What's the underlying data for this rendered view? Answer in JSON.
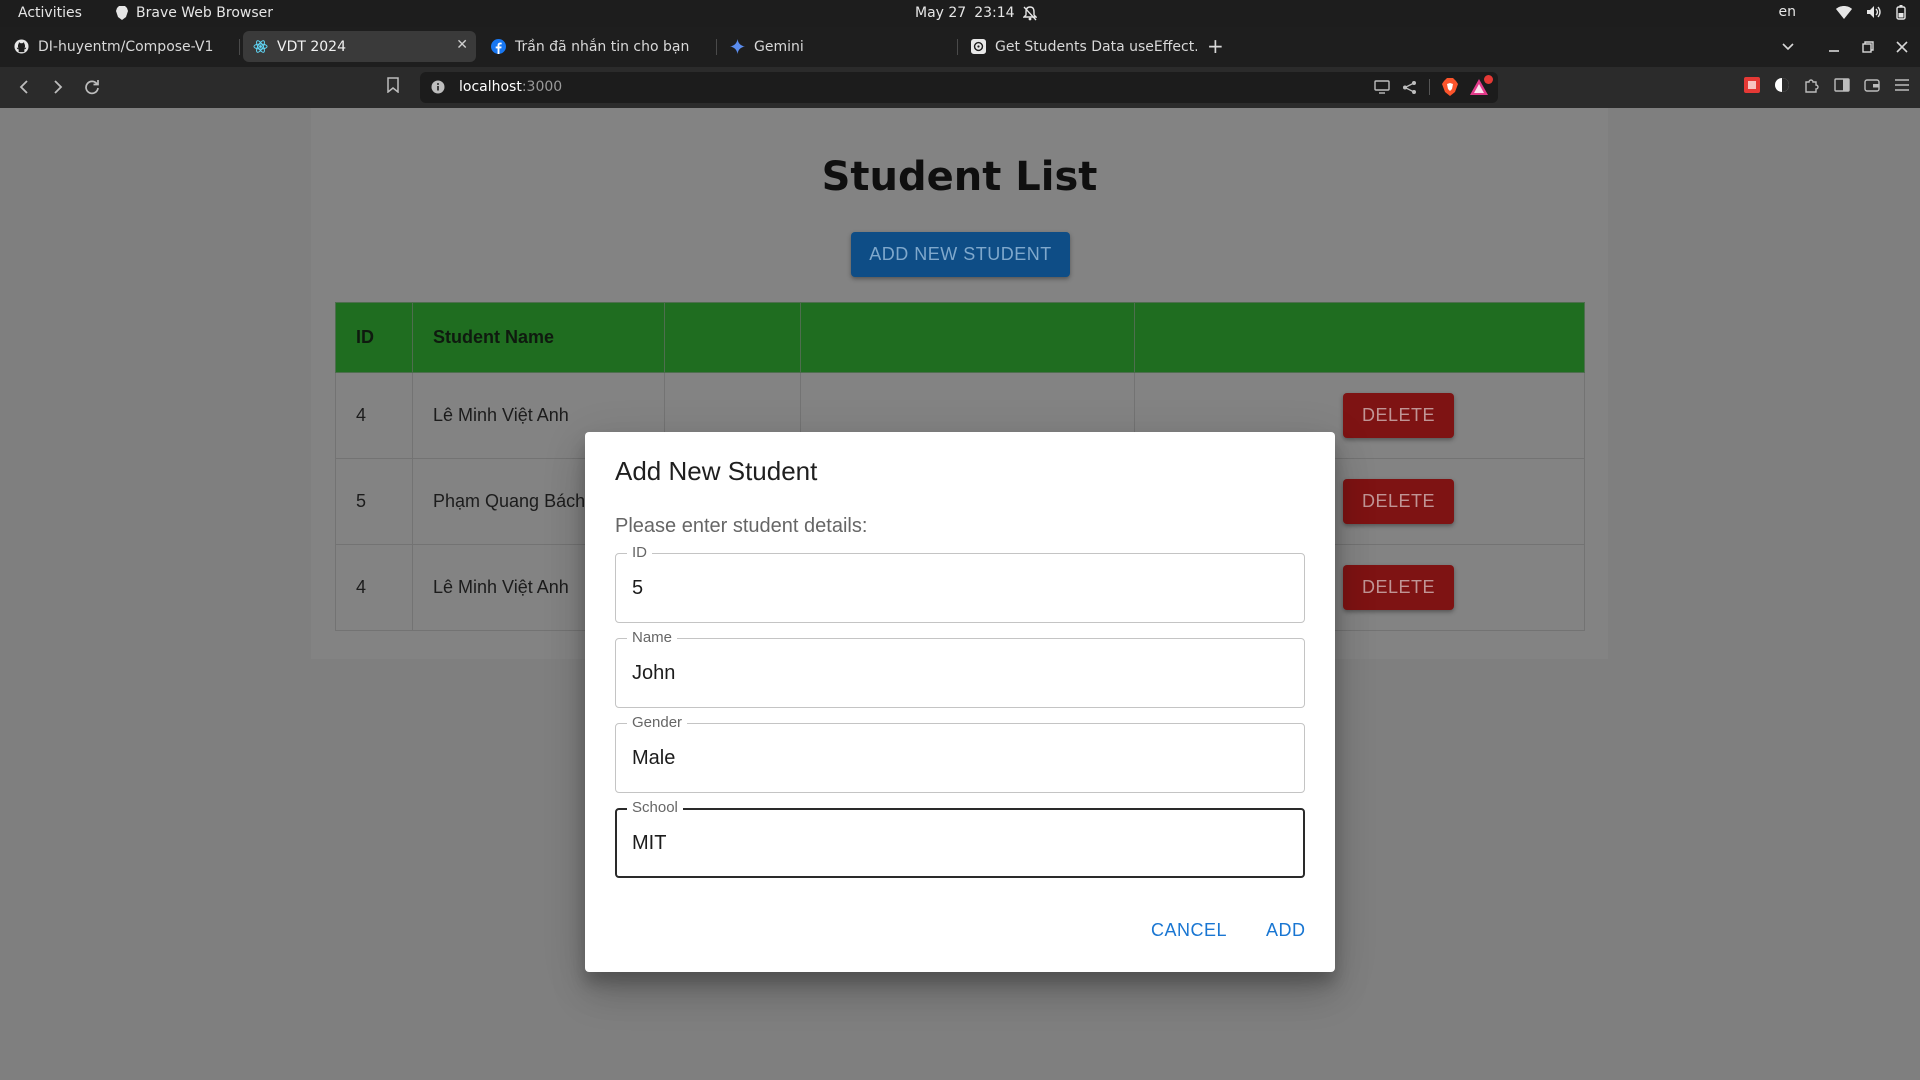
{
  "os_bar": {
    "activities": "Activities",
    "app_name": "Brave Web Browser",
    "date": "May 27",
    "time": "23:14",
    "lang": "en"
  },
  "tabs": [
    {
      "label": "DI-huyentm/Compose-V1",
      "icon": "github-icon"
    },
    {
      "label": "VDT 2024",
      "icon": "react-icon",
      "active": true
    },
    {
      "label": "Trần đã nhắn tin cho bạn",
      "icon": "facebook-icon"
    },
    {
      "label": "Gemini",
      "icon": "gemini-icon"
    },
    {
      "label": "Get Students Data useEffect.",
      "icon": "chatgpt-icon"
    }
  ],
  "address_bar": {
    "host": "localhost",
    "port": ":3000"
  },
  "page": {
    "title": "Student List",
    "add_button": "ADD NEW STUDENT",
    "table": {
      "headers": [
        "ID",
        "Student Name",
        "",
        "",
        ""
      ],
      "rows": [
        {
          "id": "4",
          "name": "Lê Minh Việt Anh",
          "action": "DELETE"
        },
        {
          "id": "5",
          "name": "Phạm Quang Bách",
          "action": "DELETE"
        },
        {
          "id": "4",
          "name": "Lê Minh Việt Anh",
          "action": "DELETE"
        }
      ]
    }
  },
  "dialog": {
    "title": "Add New Student",
    "text": "Please enter student details:",
    "fields": [
      {
        "label": "ID",
        "value": "5"
      },
      {
        "label": "Name",
        "value": "John"
      },
      {
        "label": "Gender",
        "value": "Male"
      },
      {
        "label": "School",
        "value": "MIT"
      }
    ],
    "cancel": "CANCEL",
    "add": "ADD"
  },
  "colors": {
    "table_header": "#1f6d20",
    "primary_button": "#0e4d86",
    "delete_button": "#7e1313",
    "dialog_action": "#1976d2"
  }
}
